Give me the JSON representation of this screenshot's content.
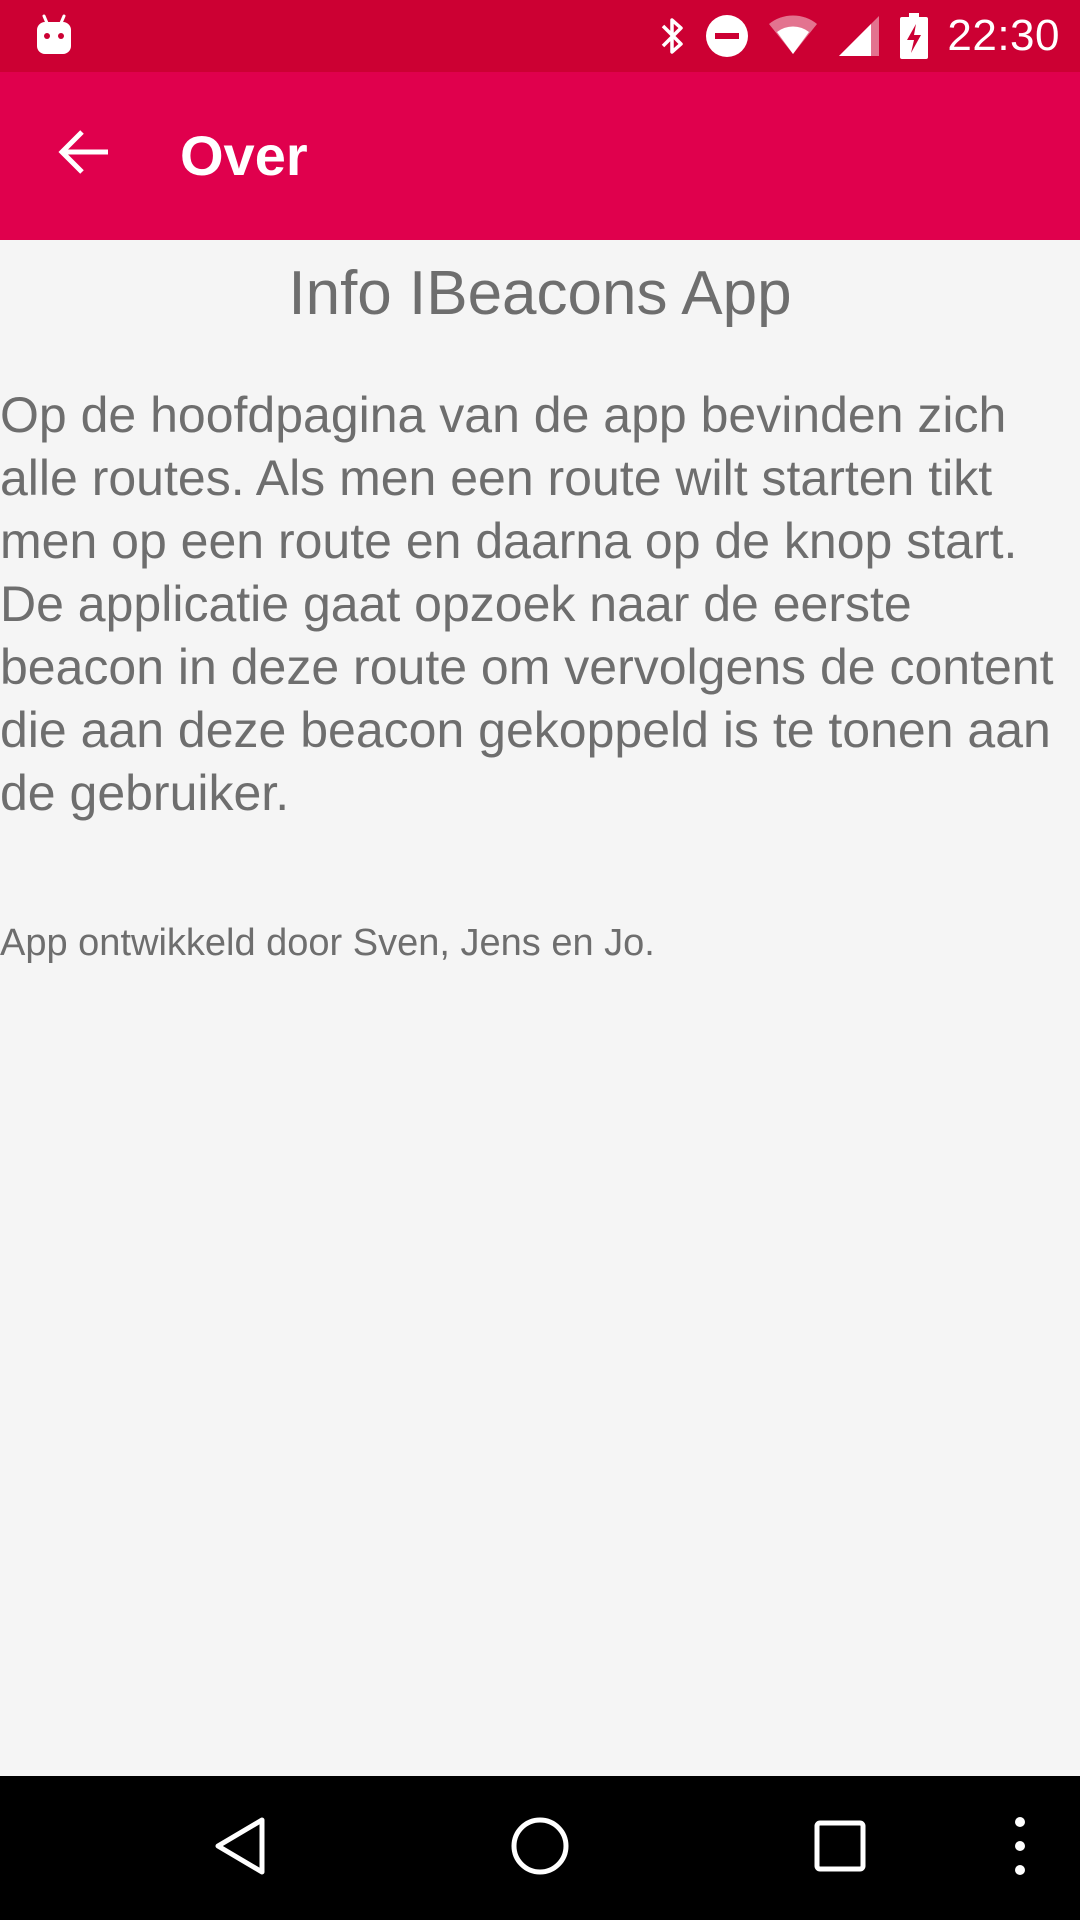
{
  "status_bar": {
    "time": "22:30",
    "icons": [
      "android-icon",
      "bluetooth-icon",
      "do-not-disturb-icon",
      "wifi-icon",
      "cell-signal-icon",
      "battery-charging-icon"
    ]
  },
  "app_bar": {
    "title": "Over",
    "back_icon": "arrow-back-icon"
  },
  "content": {
    "title": "Info IBeacons App",
    "body": "Op de hoofdpagina van de app bevinden zich alle routes. Als men een route wilt starten tikt men op een route en daarna op de knop start. De applicatie gaat opzoek naar de eerste beacon in deze route om vervolgens de content die aan deze beacon gekoppeld is te tonen aan de gebruiker.",
    "credits": "App ontwikkeld door Sven, Jens en Jo."
  },
  "nav_bar": {
    "icons": [
      "nav-back-icon",
      "nav-home-icon",
      "nav-recents-icon",
      "overflow-menu-icon"
    ]
  },
  "colors": {
    "status_bar": "#cc0033",
    "app_bar": "#e0004d",
    "background": "#f5f5f5",
    "text": "#6e6e6e",
    "nav_bar": "#000000"
  }
}
